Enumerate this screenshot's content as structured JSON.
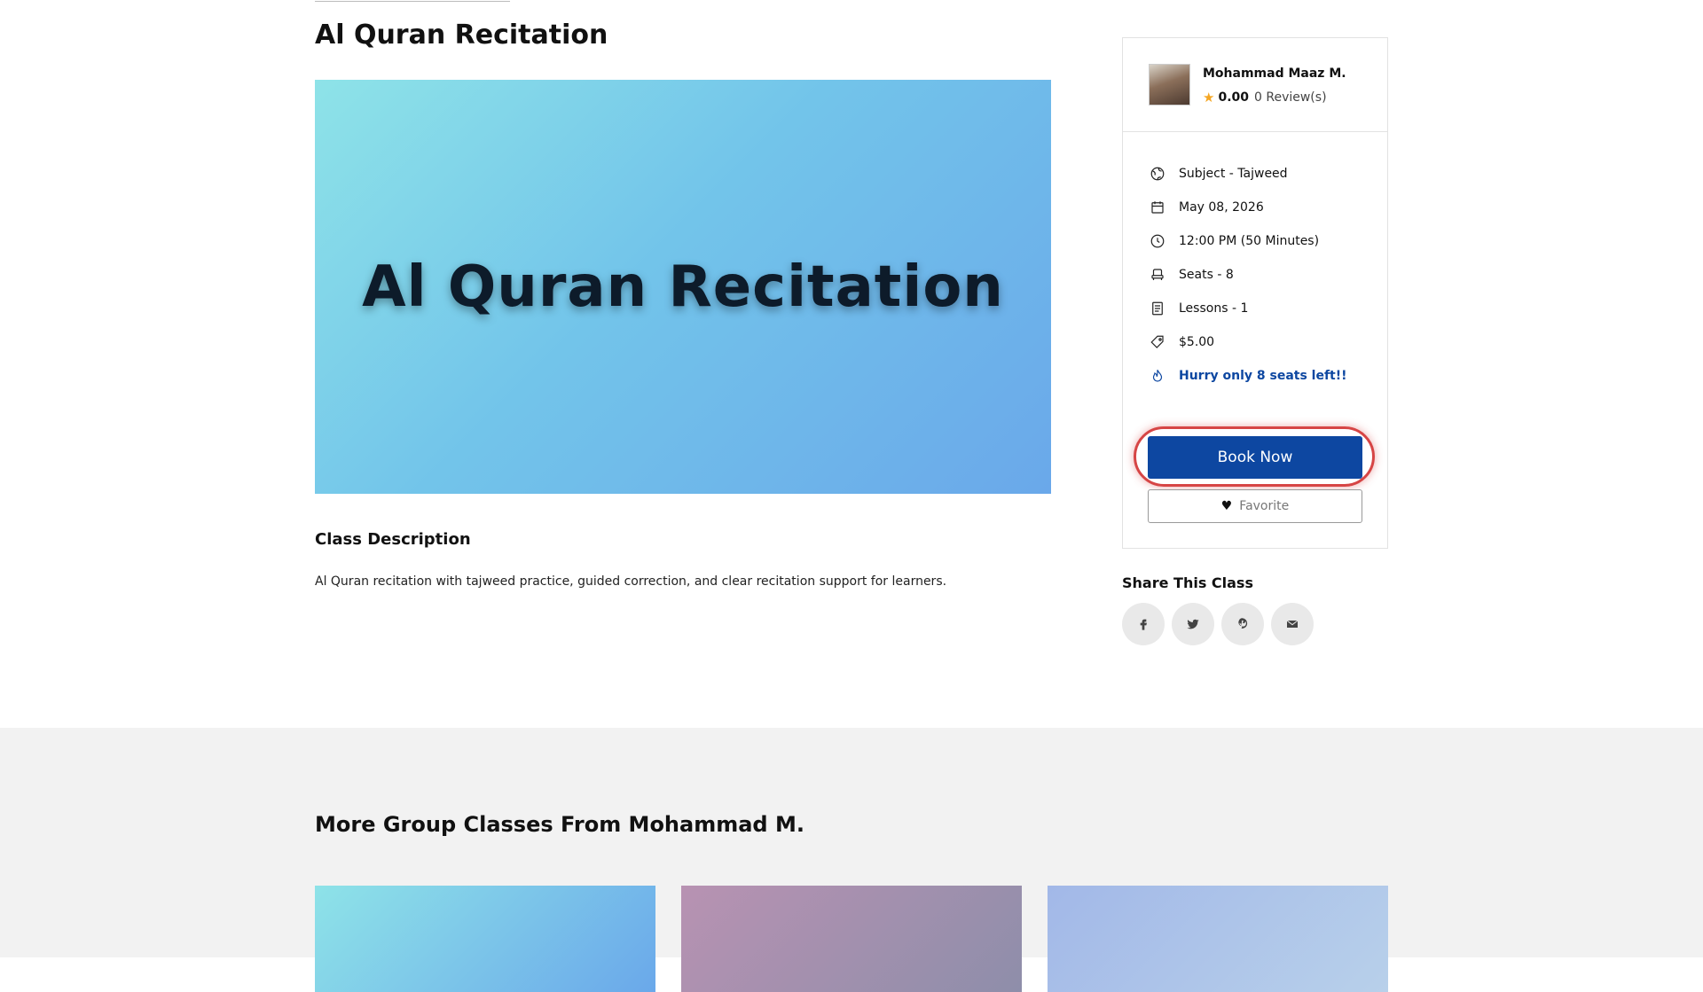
{
  "page": {
    "title": "Al Quran Recitation"
  },
  "hero": {
    "text": "Al Quran Recitation"
  },
  "description": {
    "title": "Class Description",
    "text": "Al Quran recitation with tajweed practice, guided correction, and clear recitation support for learners."
  },
  "tutor": {
    "name": "Mohammad Maaz M.",
    "rating": "0.00",
    "reviews": "0 Review(s)"
  },
  "details": {
    "subject": "Subject - Tajweed",
    "date": "May 08, 2026",
    "time": "12:00 PM (50 Minutes)",
    "seats": "Seats - 8",
    "lessons": "Lessons - 1",
    "price": "$5.00",
    "hurry": "Hurry only 8 seats left!!"
  },
  "actions": {
    "book_label": "Book Now",
    "favorite_label": "Favorite"
  },
  "share": {
    "title": "Share This Class",
    "icons": [
      "facebook-icon",
      "twitter-icon",
      "pinterest-icon",
      "email-icon"
    ]
  },
  "more": {
    "title": "More Group Classes From Mohammad M."
  },
  "colors": {
    "primary": "#0d47a1",
    "highlight_ring": "#d64545",
    "star": "#f5a623",
    "section_bg": "#f2f2f2"
  }
}
